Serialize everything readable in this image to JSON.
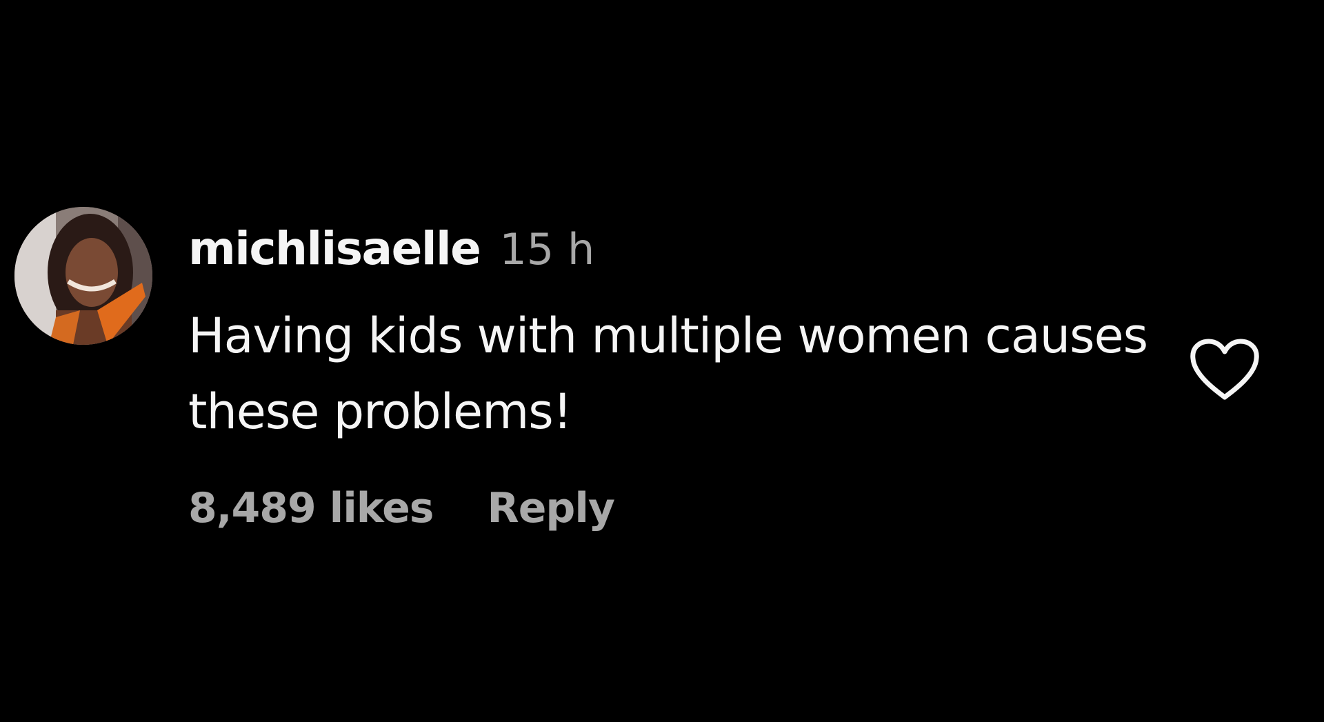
{
  "comment": {
    "username": "michlisaelle",
    "timestamp": "15 h",
    "text": "Having kids with multiple women causes these problems!",
    "likes": "8,489 likes",
    "reply_label": "Reply",
    "like_icon": "heart-outline-icon"
  },
  "colors": {
    "background": "#000000",
    "primary_text": "#f5f5f5",
    "secondary_text": "#a8a8a8"
  }
}
